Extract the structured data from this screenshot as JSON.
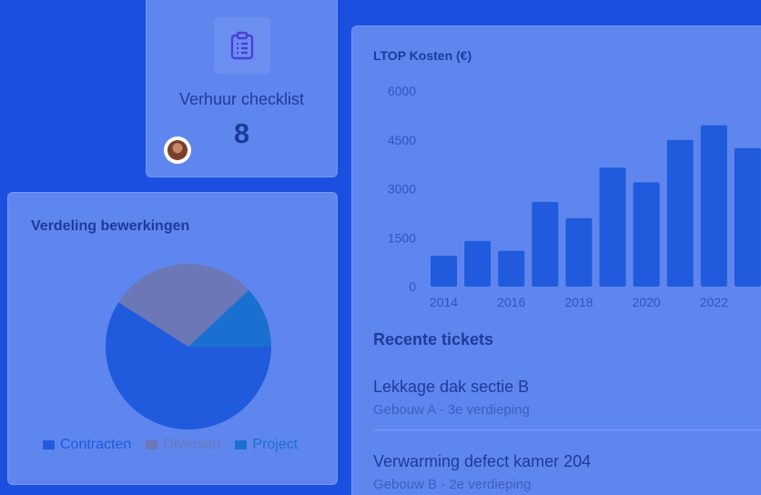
{
  "checklist": {
    "title": "Verhuur checklist",
    "count": "8",
    "icon": "clipboard-icon"
  },
  "pie": {
    "title": "Verdeling bewerkingen",
    "legend": [
      {
        "label": "Contracten",
        "color": "#1f5bdc"
      },
      {
        "label": "Diversen",
        "color": "#6c77b8"
      },
      {
        "label": "Project",
        "color": "#1a70d0"
      }
    ]
  },
  "bar": {
    "title": "LTOP Kosten (€)"
  },
  "chart_data": [
    {
      "type": "pie",
      "title": "Verdeling bewerkingen",
      "categories": [
        "Contracten",
        "Diversen",
        "Project"
      ],
      "values": [
        59,
        29,
        12
      ],
      "colors": [
        "#1f5bdc",
        "#6c77b8",
        "#1a70d0"
      ],
      "legend": "bottom"
    },
    {
      "type": "bar",
      "title": "LTOP Kosten (€)",
      "categories": [
        "2014",
        "2015",
        "2016",
        "2017",
        "2018",
        "2019",
        "2020",
        "2021",
        "2022",
        "2023"
      ],
      "values": [
        950,
        1400,
        1100,
        2600,
        2100,
        3650,
        3200,
        4500,
        4950,
        4250
      ],
      "x_tick_labels": [
        "2014",
        "2016",
        "2018",
        "2020",
        "2022"
      ],
      "y_ticks": [
        0,
        1500,
        3000,
        4500,
        6000
      ],
      "ylim": [
        0,
        6000
      ],
      "color": "#1f5bdc",
      "grid": false
    }
  ],
  "tickets": {
    "title": "Recente tickets",
    "items": [
      {
        "title": "Lekkage dak sectie B",
        "subtitle": "Gebouw A - 3e verdieping"
      },
      {
        "title": "Verwarming defect kamer 204",
        "subtitle": "Gebouw B - 2e verdieping"
      }
    ]
  }
}
